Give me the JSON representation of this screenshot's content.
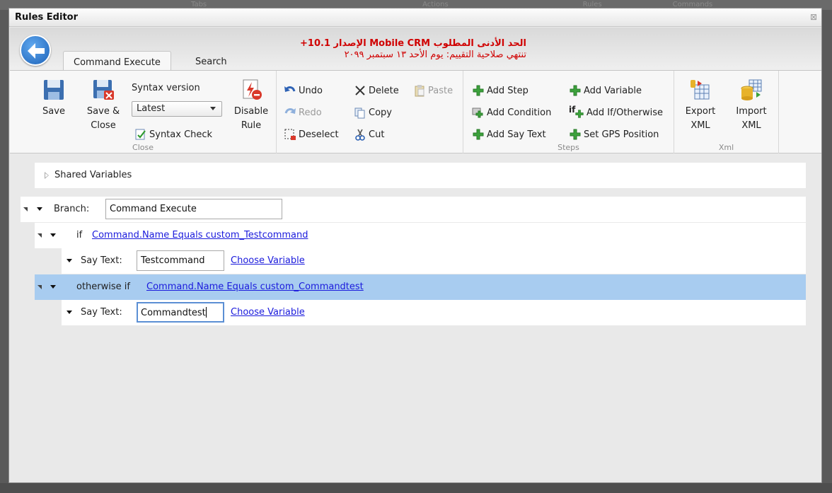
{
  "background": {
    "tabs": [
      "Tabs",
      "Actions",
      "Rules",
      "Commands"
    ]
  },
  "window": {
    "title": "Rules Editor",
    "close_symbol": "⊠"
  },
  "header": {
    "back_icon": "back-arrow-icon",
    "tabs": [
      {
        "label": "Command Execute",
        "active": true
      },
      {
        "label": "Search",
        "active": false
      }
    ],
    "notice": {
      "line1": "الحد الأدنى المطلوب Mobile CRM الإصدار 10.1+",
      "line2": "تنتهي صلاحية التقييم: يوم الأحد ١٣ سبتمبر ٢٠٩٩",
      "color": "#d00000"
    }
  },
  "ribbon": {
    "close_group": {
      "label": "Close",
      "save": "Save",
      "save_close_line1": "Save &",
      "save_close_line2": "Close",
      "syntax_version_label": "Syntax version",
      "syntax_version_value": "Latest",
      "syntax_check": "Syntax Check",
      "disable_line1": "Disable",
      "disable_line2": "Rule"
    },
    "edit_group": {
      "undo": "Undo",
      "redo": "Redo",
      "deselect": "Deselect",
      "delete": "Delete",
      "copy": "Copy",
      "cut": "Cut",
      "paste": "Paste"
    },
    "steps_group": {
      "label": "Steps",
      "add_step": "Add Step",
      "add_condition": "Add Condition",
      "add_say_text": "Add Say Text",
      "add_variable": "Add Variable",
      "add_if_otherwise": "Add If/Otherwise",
      "set_gps_position": "Set GPS Position",
      "if_prefix": "if"
    },
    "xml_group": {
      "label": "Xml",
      "export_line1": "Export",
      "export_line2": "XML",
      "import_line1": "Import",
      "import_line2": "XML"
    }
  },
  "tree": {
    "shared_variables": "Shared Variables",
    "branch_label": "Branch:",
    "branch_value": "Command Execute",
    "if_label": "if",
    "if_condition": "Command.Name Equals custom_Testcommand",
    "say1_label": "Say Text:",
    "say1_value": "Testcommand",
    "say1_choose": "Choose Variable",
    "otherwise_label": "otherwise if",
    "otherwise_condition": "Command.Name Equals custom_Commandtest",
    "say2_label": "Say Text:",
    "say2_value": "Commandtest",
    "say2_choose": "Choose Variable"
  },
  "colors": {
    "selected_row": "#a8ccf0",
    "link": "#1a1adc",
    "accent_blue": "#1d62b8"
  }
}
